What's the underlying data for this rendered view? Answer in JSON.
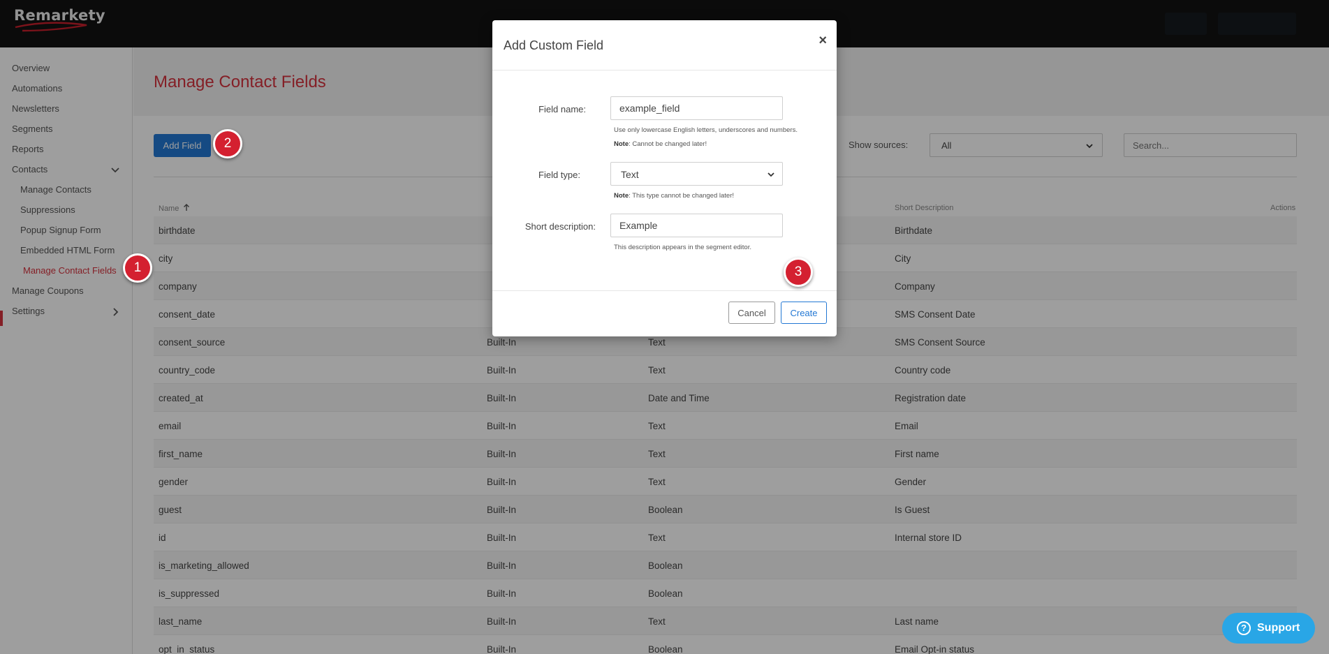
{
  "app": {
    "logo_text": "Remarkety"
  },
  "sidebar": {
    "items": [
      {
        "label": "Overview"
      },
      {
        "label": "Automations"
      },
      {
        "label": "Newsletters"
      },
      {
        "label": "Segments"
      },
      {
        "label": "Reports"
      },
      {
        "label": "Contacts"
      },
      {
        "label": "Manage Contacts"
      },
      {
        "label": "Suppressions"
      },
      {
        "label": "Popup Signup Form"
      },
      {
        "label": "Embedded HTML Form"
      },
      {
        "label": "Manage Contact Fields"
      },
      {
        "label": "Manage Coupons"
      },
      {
        "label": "Settings"
      }
    ],
    "active_item": "Manage Contact Fields"
  },
  "main": {
    "title": "Manage Contact Fields",
    "add_field_label": "Add Field",
    "show_sources_label": "Show sources:",
    "sources_selected": "All",
    "search_placeholder": "Search..."
  },
  "table": {
    "columns": {
      "name": "Name",
      "short_description": "Short Description",
      "actions": "Actions"
    },
    "rows": [
      {
        "name": "birthdate",
        "source": "",
        "type": "",
        "description": "Birthdate"
      },
      {
        "name": "city",
        "source": "",
        "type": "",
        "description": "City"
      },
      {
        "name": "company",
        "source": "",
        "type": "",
        "description": "Company"
      },
      {
        "name": "consent_date",
        "source": "",
        "type": "",
        "description": "SMS Consent Date"
      },
      {
        "name": "consent_source",
        "source": "Built-In",
        "type": "Text",
        "description": "SMS Consent Source"
      },
      {
        "name": "country_code",
        "source": "Built-In",
        "type": "Text",
        "description": "Country code"
      },
      {
        "name": "created_at",
        "source": "Built-In",
        "type": "Date and Time",
        "description": "Registration date"
      },
      {
        "name": "email",
        "source": "Built-In",
        "type": "Text",
        "description": "Email"
      },
      {
        "name": "first_name",
        "source": "Built-In",
        "type": "Text",
        "description": "First name"
      },
      {
        "name": "gender",
        "source": "Built-In",
        "type": "Text",
        "description": "Gender"
      },
      {
        "name": "guest",
        "source": "Built-In",
        "type": "Boolean",
        "description": "Is Guest"
      },
      {
        "name": "id",
        "source": "Built-In",
        "type": "Text",
        "description": "Internal store ID"
      },
      {
        "name": "is_marketing_allowed",
        "source": "Built-In",
        "type": "Boolean",
        "description": ""
      },
      {
        "name": "is_suppressed",
        "source": "Built-In",
        "type": "Boolean",
        "description": ""
      },
      {
        "name": "last_name",
        "source": "Built-In",
        "type": "Text",
        "description": "Last name"
      },
      {
        "name": "opt_in_status",
        "source": "Built-In",
        "type": "Boolean",
        "description": "Email Opt-in status"
      }
    ]
  },
  "modal": {
    "title": "Add Custom Field",
    "close_symbol": "×",
    "field_name_label": "Field name:",
    "field_name_value": "example_field",
    "field_name_hint": "Use only lowercase English letters, underscores and numbers.",
    "field_name_note_prefix": "Note",
    "field_name_note": ": Cannot be changed later!",
    "field_type_label": "Field type:",
    "field_type_value": "Text",
    "field_type_note_prefix": "Note",
    "field_type_note": ": This type cannot be changed later!",
    "short_desc_label": "Short description:",
    "short_desc_value": "Example",
    "short_desc_hint": "This description appears in the segment editor.",
    "cancel_label": "Cancel",
    "create_label": "Create"
  },
  "annotations": {
    "step1": "1",
    "step2": "2",
    "step3": "3"
  },
  "support": {
    "label": "Support",
    "icon": "?"
  },
  "colors": {
    "accent_red": "#d6323e",
    "primary_blue": "#2378d4",
    "support_blue": "#29a6e6"
  }
}
